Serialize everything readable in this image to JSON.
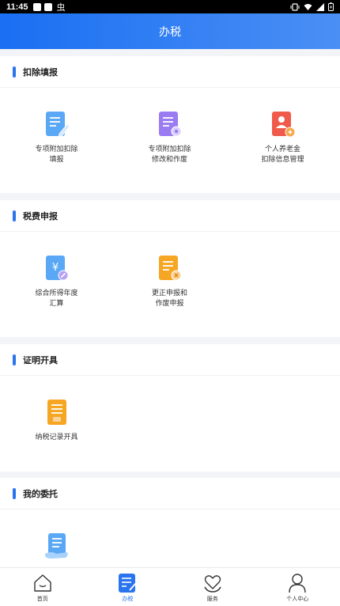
{
  "status_bar": {
    "time": "11:45",
    "icon_glyph": "虫"
  },
  "header": {
    "title": "办税"
  },
  "sections": [
    {
      "title": "扣除填报",
      "items": [
        {
          "label": "专项附加扣除\n填报",
          "icon": "doc-edit-icon"
        },
        {
          "label": "专项附加扣除\n修改和作废",
          "icon": "doc-settings-icon"
        },
        {
          "label": "个人养老金\n扣除信息管理",
          "icon": "pension-icon"
        }
      ]
    },
    {
      "title": "税费申报",
      "items": [
        {
          "label": "综合所得年度\n汇算",
          "icon": "yuan-doc-icon"
        },
        {
          "label": "更正申报和\n作废申报",
          "icon": "doc-cancel-icon"
        }
      ]
    },
    {
      "title": "证明开具",
      "items": [
        {
          "label": "纳税记录开具",
          "icon": "certificate-icon"
        }
      ]
    },
    {
      "title": "我的委托",
      "items": [
        {
          "label": "",
          "icon": "entrust-icon"
        }
      ]
    }
  ],
  "tabbar": {
    "tabs": [
      {
        "label": "首页",
        "icon": "home-icon"
      },
      {
        "label": "办税",
        "icon": "tax-icon",
        "active": true
      },
      {
        "label": "服务",
        "icon": "service-icon"
      },
      {
        "label": "个人中心",
        "icon": "user-icon"
      }
    ]
  },
  "colors": {
    "accent": "#2b74f0",
    "header_start": "#1a6ff2",
    "header_end": "#4b8ff5",
    "orange": "#f5a623",
    "red": "#f05a4a",
    "purple": "#8b6cf0"
  }
}
